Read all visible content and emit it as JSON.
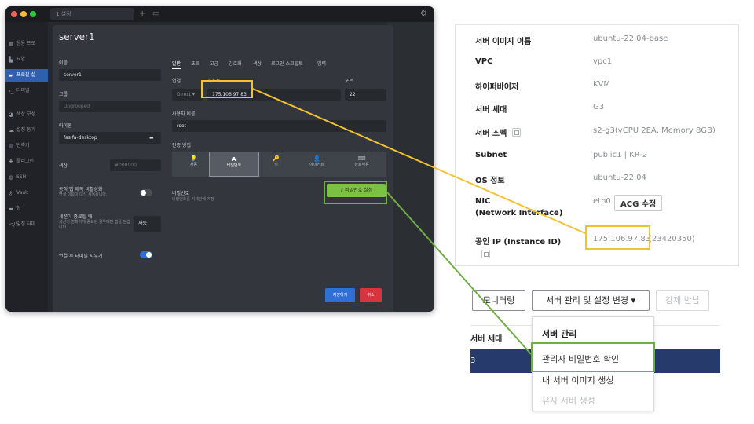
{
  "colors": {
    "highlight_yellow": "#f2c230",
    "highlight_green": "#6fae46",
    "app_bg": "#26292e",
    "modal_bg": "#33363c",
    "accent_blue": "#2f6fd6",
    "accent_green": "#7cc242",
    "accent_red": "#d9333f"
  },
  "app": {
    "tab_label": "1  설정",
    "new_tab_icon": "plus-icon",
    "sidebar": {
      "items": [
        {
          "label": "응용 프로",
          "icon": "grid-icon"
        },
        {
          "label": "요양",
          "icon": "bars-icon"
        },
        {
          "label": "프로필 설",
          "icon": "folder-icon"
        },
        {
          "label": "터미널",
          "icon": "terminal-icon"
        },
        {
          "label": "색상 구성",
          "icon": "palette-icon"
        },
        {
          "label": "설정 동기",
          "icon": "cloud-icon"
        },
        {
          "label": "단축키",
          "icon": "keyboard-icon"
        },
        {
          "label": "플러그인",
          "icon": "puzzle-icon"
        },
        {
          "label": "SSH",
          "icon": "globe-icon"
        },
        {
          "label": "Vault",
          "icon": "key-icon"
        },
        {
          "label": "창",
          "icon": "window-icon"
        },
        {
          "label": "일정 터미",
          "icon": "code-icon"
        }
      ]
    }
  },
  "modal": {
    "title": "server1",
    "left": {
      "name_label": "이름",
      "name_value": "server1",
      "group_label": "그룹",
      "group_placeholder": "Ungrouped",
      "icon_label": "아이콘",
      "icon_value": "fas fa-desktop",
      "color_label": "색상",
      "color_placeholder": "#000000",
      "dynamic_title_label": "동적 탭 제목 비활성화",
      "dynamic_title_desc": "연결 이름이 대신 사용됩니다.",
      "session_end_label": "세션이 종료될 때",
      "session_end_desc": "세션이 명확하게 종료된 경우에만 탭을 닫습니다.",
      "session_end_value": "자동",
      "clear_terminal_label": "연결 후 터미널 지우기"
    },
    "tabs": [
      "일반",
      "포트",
      "고급",
      "암호화",
      "색상",
      "로그인 스크립트",
      "입력"
    ],
    "connection_label": "연결",
    "connection_value": "Direct",
    "host_label": "호스트",
    "host_value": "175.106.97.83",
    "port_label": "포트",
    "port_value": "22",
    "username_label": "사용자 이름",
    "username_value": "root",
    "auth_label": "인증 방법",
    "auth_methods": [
      {
        "label": "자동",
        "glyph": "💡"
      },
      {
        "label": "비밀번호",
        "glyph": "A"
      },
      {
        "label": "키",
        "glyph": "🔑"
      },
      {
        "label": "에이전트",
        "glyph": "👤"
      },
      {
        "label": "상호작용",
        "glyph": "⌨"
      }
    ],
    "password_label": "비밀번호",
    "password_desc": "비밀번호를 키체인에 저장",
    "password_button": "비밀번호 설정",
    "save_button": "저장하기",
    "cancel_button": "취소"
  },
  "info": {
    "rows": [
      {
        "key": "서버 이미지 이름",
        "value": "ubuntu-22.04-base"
      },
      {
        "key": "VPC",
        "value": "vpc1"
      },
      {
        "key": "하이퍼바이저",
        "value": "KVM"
      },
      {
        "key": "서버 세대",
        "value": "G3"
      },
      {
        "key": "서버 스펙",
        "value": "s2-g3(vCPU 2EA, Memory 8GB)"
      },
      {
        "key": "Subnet",
        "value": "public1 | KR-2"
      },
      {
        "key": "OS 정보",
        "value": "ubuntu-22.04"
      }
    ],
    "nic_key_line1": "NIC",
    "nic_key_line2": "(Network Interface)",
    "nic_value": "eth0",
    "acg_button": "ACG 수정",
    "public_ip_key": "공인 IP (Instance ID)",
    "public_ip_value": "175.106.97.83",
    "instance_id_suffix": "(23420350)"
  },
  "menu": {
    "monitoring_button": "모니터링",
    "manage_button": "서버 관리 및 설정 변경",
    "return_button": "강제 반납",
    "bg_header": "서버 세대",
    "bg_row_value": "3",
    "dropdown_header": "서버 관리",
    "dropdown_items": [
      "관리자 비밀번호 확인",
      "내 서버 이미지 생성",
      "유사 서버 생성"
    ]
  }
}
